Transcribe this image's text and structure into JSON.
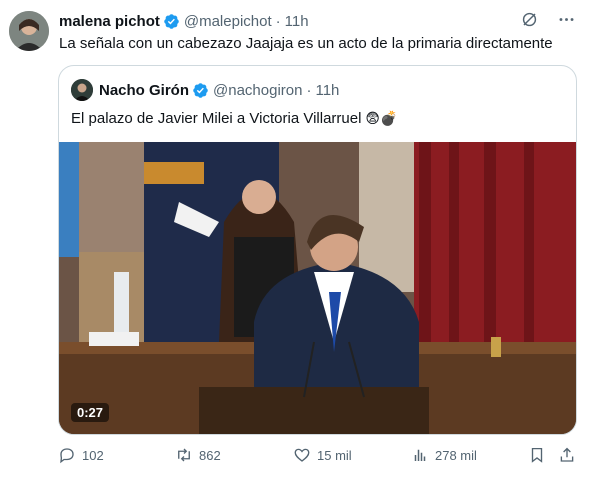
{
  "tweet": {
    "author_name": "malena pichot",
    "author_handle": "@malepichot",
    "separator": "·",
    "time": "11h",
    "text": "La señala con un cabezazo Jaajaja es un acto de la primaria directamente"
  },
  "quoted": {
    "author_name": "Nacho Girón",
    "author_handle": "@nachogiron",
    "separator": "·",
    "time": "11h",
    "text": "El palazo de Javier Milei a Victoria Villarruel",
    "emojis": "😨💣",
    "video_duration": "0:27"
  },
  "actions": {
    "replies": "102",
    "reposts": "862",
    "likes": "15 mil",
    "views": "278 mil"
  },
  "icons": {
    "verified": "verified-badge-icon",
    "grok": "grok-icon",
    "more": "more-options-icon",
    "reply": "reply-icon",
    "repost": "repost-icon",
    "like": "heart-icon",
    "views": "views-icon",
    "bookmark": "bookmark-icon",
    "share": "share-icon"
  },
  "colors": {
    "verified_blue": "#1d9bf0",
    "secondary_text": "#536471",
    "border": "#cfd9de"
  }
}
